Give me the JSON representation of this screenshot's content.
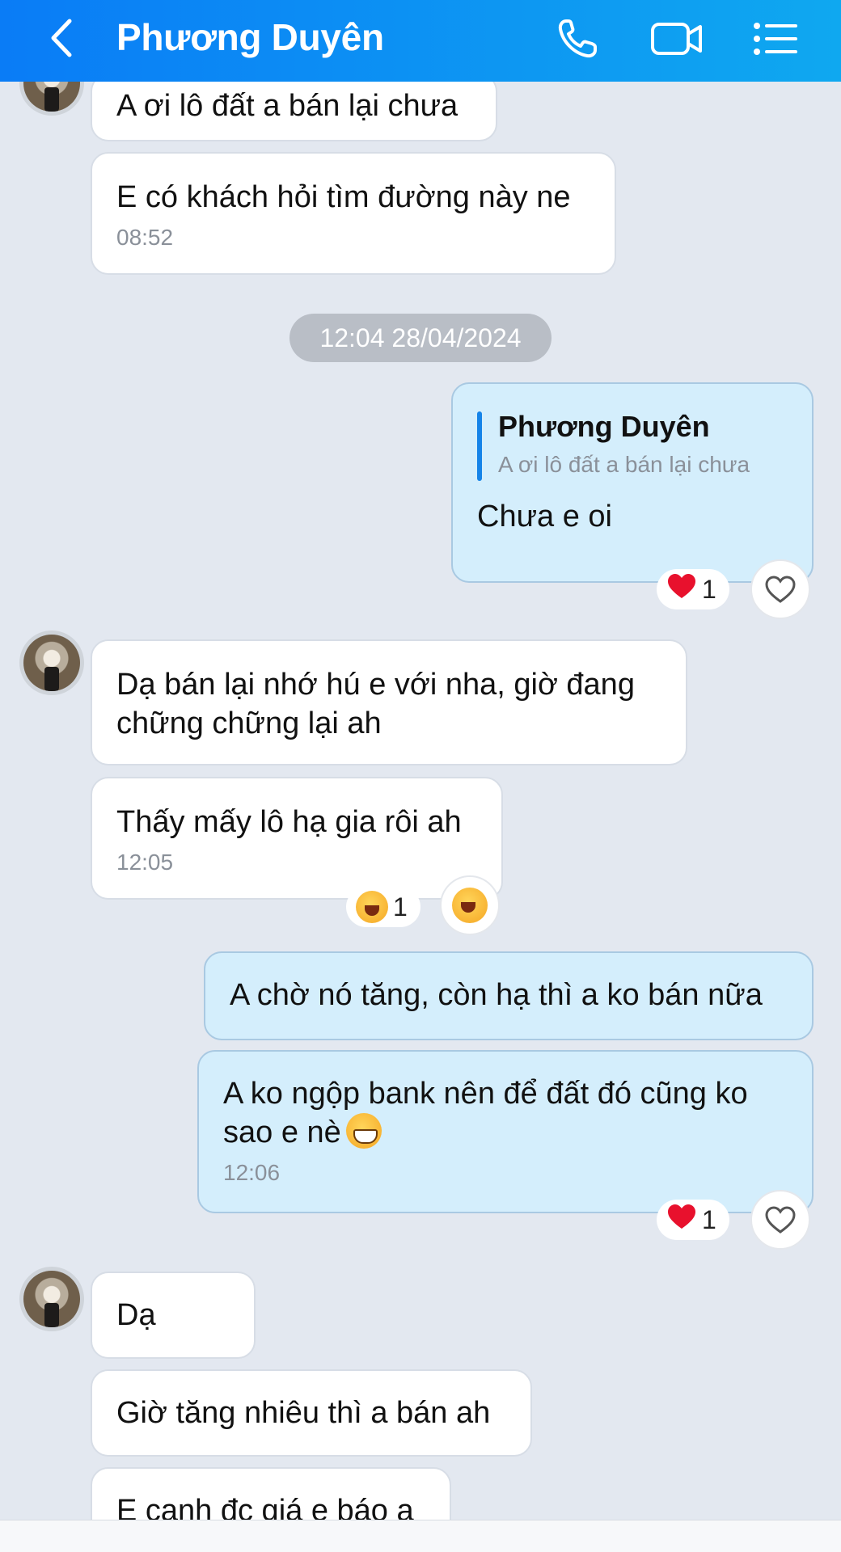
{
  "header": {
    "title": "Phương Duyên",
    "icons": [
      "back-chevron-icon",
      "phone-icon",
      "video-call-icon",
      "menu-list-icon"
    ]
  },
  "messages": {
    "m1": {
      "text": "A ơi lô đất a bán lại chưa"
    },
    "m2": {
      "text": "E có khách hỏi tìm đường này ne",
      "time": "08:52"
    },
    "date_separator": "12:04 28/04/2024",
    "m3": {
      "quote_name": "Phương Duyên",
      "quote_text": "A ơi lô đất a bán lại chưa",
      "text": "Chưa e oi",
      "reaction": {
        "emoji": "heart",
        "count": "1"
      }
    },
    "m4": {
      "text": "Dạ bán lại nhớ hú e với nha, giờ đang chững chững lại ah"
    },
    "m5": {
      "text": "Thấy mấy lô hạ gia rôi ah",
      "time": "12:05",
      "reaction": {
        "emoji": "laughing",
        "count": "1"
      }
    },
    "m6": {
      "text": "A chờ nó tăng, còn hạ thì a ko bán nữa"
    },
    "m7": {
      "text": "A ko ngộp bank nên để đất đó cũng ko sao e nè",
      "time": "12:06",
      "reaction": {
        "emoji": "heart",
        "count": "1"
      }
    },
    "m8": {
      "text": "Dạ"
    },
    "m9": {
      "text": "Giờ tăng nhiêu thì a bán ah"
    },
    "m10": {
      "text": "E canh đc giá e báo a"
    }
  },
  "colors": {
    "header_gradient_start": "#0a7cf6",
    "header_gradient_end": "#0fa8f0",
    "chat_background": "#e3e8f0",
    "outgoing_bubble": "#d4eefc",
    "incoming_bubble": "#ffffff"
  }
}
